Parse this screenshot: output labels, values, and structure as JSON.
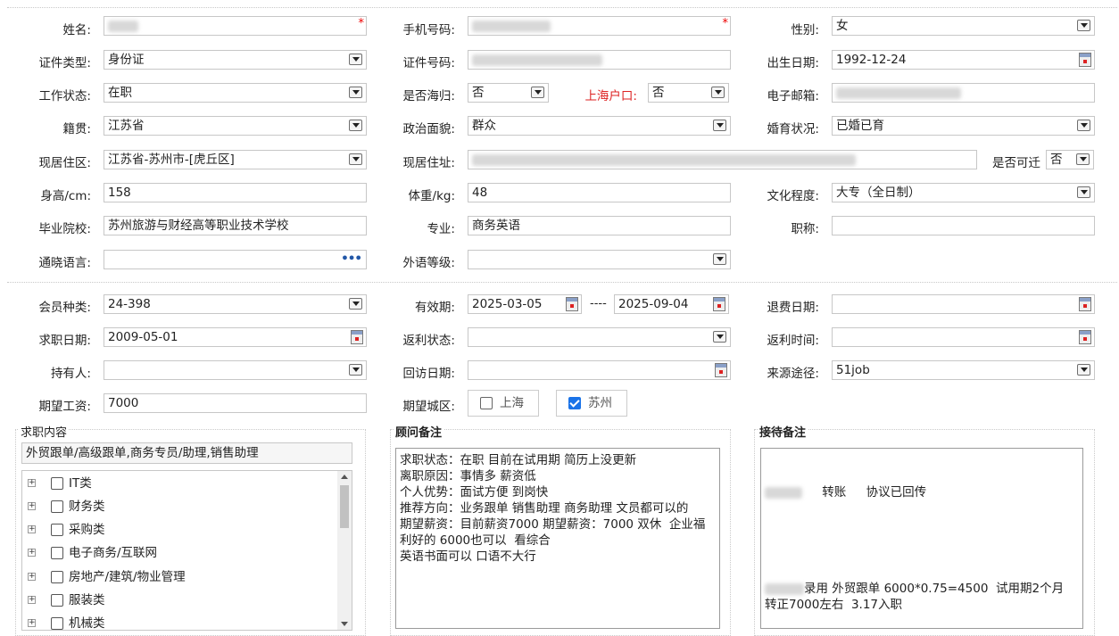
{
  "personal": {
    "name_label": "姓名:",
    "phone_label": "手机号码:",
    "gender_label": "性别:",
    "gender_value": "女",
    "idtype_label": "证件类型:",
    "idtype_value": "身份证",
    "idno_label": "证件号码:",
    "birth_label": "出生日期:",
    "birth_value": "1992-12-24",
    "workstatus_label": "工作状态:",
    "workstatus_value": "在职",
    "overseas_label": "是否海归:",
    "overseas_value": "否",
    "shanghai_label": "上海户口:",
    "shanghai_value": "否",
    "email_label": "电子邮箱:",
    "native_label": "籍贯:",
    "native_value": "江苏省",
    "political_label": "政治面貌:",
    "political_value": "群众",
    "marital_label": "婚育状况:",
    "marital_value": "已婚已育",
    "region_label": "现居住区:",
    "region_value": "江苏省-苏州市-[虎丘区]",
    "address_label": "现居住址:",
    "relocate_label": "是否可迁",
    "relocate_value": "否",
    "height_label": "身高/cm:",
    "height_value": "158",
    "weight_label": "体重/kg:",
    "weight_value": "48",
    "education_label": "文化程度:",
    "education_value": "大专（全日制）",
    "school_label": "毕业院校:",
    "school_value": "苏州旅游与财经高等职业技术学校",
    "major_label": "专业:",
    "major_value": "商务英语",
    "title_label": "职称:",
    "title_value": "",
    "languages_label": "通晓语言:",
    "languages_more": "•••",
    "langlevel_label": "外语等级:",
    "required_mark": "*"
  },
  "membership": {
    "type_label": "会员种类:",
    "type_value": "24-398",
    "valid_label": "有效期:",
    "valid_from": "2025-03-05",
    "valid_sep": "----",
    "valid_to": "2025-09-04",
    "refund_label": "退费日期:",
    "jobdate_label": "求职日期:",
    "jobdate_value": "2009-05-01",
    "rebate_status_label": "返利状态:",
    "rebate_time_label": "返利时间:",
    "holder_label": "持有人:",
    "visit_label": "回访日期:",
    "source_label": "来源途径:",
    "source_value": "51job",
    "salary_label": "期望工资:",
    "salary_value": "7000",
    "city_label": "期望城区:",
    "cities": [
      {
        "name": "上海",
        "checked": false
      },
      {
        "name": "苏州",
        "checked": true
      }
    ]
  },
  "job_content": {
    "title": "求职内容",
    "summary": "外贸跟单/高级跟单,商务专员/助理,销售助理",
    "categories": [
      "IT类",
      "财务类",
      "采购类",
      "电子商务/互联网",
      "房地产/建筑/物业管理",
      "服装类",
      "机械类"
    ]
  },
  "advisor_notes": {
    "title": "顾问备注",
    "text": "求职状态：在职 目前在试用期 简历上没更新\n离职原因：事情多 薪资低\n个人优势：面试方便 到岗快\n推荐方向：业务跟单 销售助理 商务助理 文员都可以的\n期望薪资：目前薪资7000 期望薪资：7000 双休  企业福利好的 6000也可以  看综合\n英语书面可以 口语不大行"
  },
  "reception_notes": {
    "title": "接待备注",
    "line1_a": "转账",
    "line1_b": "协议已回传",
    "line2": "录用 外贸跟单 6000*0.75=4500  试用期2个月 转正7000左右  3.17入职"
  }
}
